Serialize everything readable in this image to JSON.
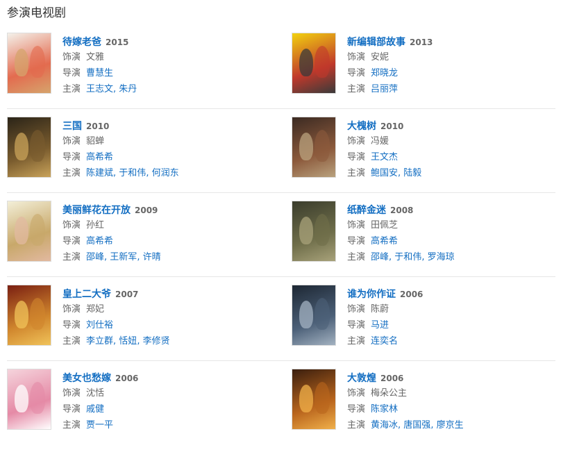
{
  "page_title": "参演电视剧",
  "labels": {
    "role": "饰演",
    "director": "导演",
    "cast": "主演"
  },
  "rows": [
    [
      {
        "title": "待嫁老爸",
        "year": "2015",
        "role": "文雅",
        "director": [
          "曹慧生"
        ],
        "cast": [
          "王志文",
          "朱丹"
        ],
        "poster_colors": [
          "#f4f1ea",
          "#e36b4f",
          "#d6a46c"
        ]
      },
      {
        "title": "新编辑部故事",
        "year": "2013",
        "role": "安妮",
        "director": [
          "郑晓龙"
        ],
        "cast": [
          "吕丽萍"
        ],
        "poster_colors": [
          "#f2d20f",
          "#c0392b",
          "#3a3a3a"
        ]
      }
    ],
    [
      {
        "title": "三国",
        "year": "2010",
        "role": "貂蝉",
        "director": [
          "高希希"
        ],
        "cast": [
          "陈建斌",
          "于和伟",
          "何润东"
        ],
        "poster_colors": [
          "#2b2418",
          "#7a5c2e",
          "#c9a35a"
        ]
      },
      {
        "title": "大槐树",
        "year": "2010",
        "role": "冯媛",
        "director": [
          "王文杰"
        ],
        "cast": [
          "鲍国安",
          "陆毅"
        ],
        "poster_colors": [
          "#3b2a22",
          "#8c5a3c",
          "#b9a27e"
        ]
      }
    ],
    [
      {
        "title": "美丽鲜花在开放",
        "year": "2009",
        "role": "孙红",
        "director": [
          "高希希"
        ],
        "cast": [
          "邵峰",
          "王新军",
          "许晴"
        ],
        "poster_colors": [
          "#f3efd8",
          "#c8a86a",
          "#e2b9a0"
        ]
      },
      {
        "title": "纸醉金迷",
        "year": "2008",
        "role": "田佩芝",
        "director": [
          "高希希"
        ],
        "cast": [
          "邵峰",
          "于和伟",
          "罗海琼"
        ],
        "poster_colors": [
          "#3a3c2c",
          "#6f6e4a",
          "#a8a27a"
        ]
      }
    ],
    [
      {
        "title": "皇上二大爷",
        "year": "2007",
        "role": "郑妃",
        "director": [
          "刘仕裕"
        ],
        "cast": [
          "李立群",
          "恬妞",
          "李修贤"
        ],
        "poster_colors": [
          "#7a1f12",
          "#d0862d",
          "#f0c35a"
        ]
      },
      {
        "title": "谁为你作证",
        "year": "2006",
        "role": "陈蔚",
        "director": [
          "马进"
        ],
        "cast": [
          "连奕名"
        ],
        "poster_colors": [
          "#1d2733",
          "#4c6078",
          "#a3b2c1"
        ]
      }
    ],
    [
      {
        "title": "美女也愁嫁",
        "year": "2006",
        "role": "沈恬",
        "director": [
          "戚健"
        ],
        "cast": [
          "贾一平"
        ],
        "poster_colors": [
          "#f5d4dc",
          "#e58aa6",
          "#ffffff"
        ]
      },
      {
        "title": "大敦煌",
        "year": "2006",
        "role": "梅朵公主",
        "director": [
          "陈家林"
        ],
        "cast": [
          "黄海冰",
          "唐国强",
          "廖京生"
        ],
        "poster_colors": [
          "#3a1e0e",
          "#b9651d",
          "#f0b04a"
        ]
      }
    ]
  ]
}
